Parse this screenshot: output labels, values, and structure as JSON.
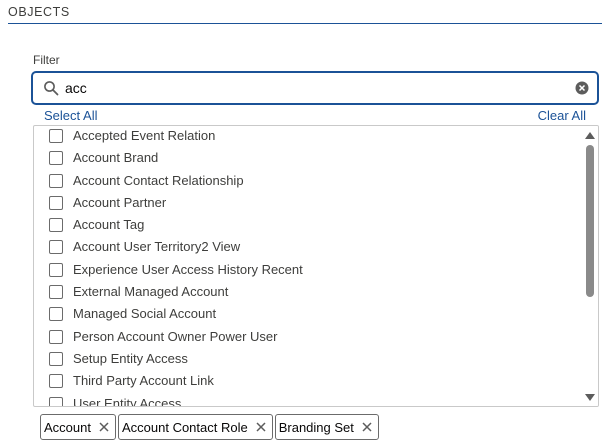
{
  "section": {
    "title": "OBJECTS"
  },
  "filter": {
    "label": "Filter",
    "value": "acc",
    "placeholder": ""
  },
  "actions": {
    "select_all": "Select All",
    "clear_all": "Clear All"
  },
  "items": [
    {
      "label": "Accepted Event Relation",
      "checked": false
    },
    {
      "label": "Account Brand",
      "checked": false
    },
    {
      "label": "Account Contact Relationship",
      "checked": false
    },
    {
      "label": "Account Partner",
      "checked": false
    },
    {
      "label": "Account Tag",
      "checked": false
    },
    {
      "label": "Account User Territory2 View",
      "checked": false
    },
    {
      "label": "Experience User Access History Recent",
      "checked": false
    },
    {
      "label": "External Managed Account",
      "checked": false
    },
    {
      "label": "Managed Social Account",
      "checked": false
    },
    {
      "label": "Person Account Owner Power User",
      "checked": false
    },
    {
      "label": "Setup Entity Access",
      "checked": false
    },
    {
      "label": "Third Party Account Link",
      "checked": false
    },
    {
      "label": "User Entity Access",
      "checked": false
    }
  ],
  "selected": [
    {
      "label": "Account"
    },
    {
      "label": "Account Contact Role"
    },
    {
      "label": "Branding Set"
    }
  ],
  "icons": {
    "search": "search-icon",
    "clear": "clear-circle-icon",
    "remove": "close-icon"
  },
  "colors": {
    "accent": "#1b5297",
    "border": "#c9c9c9",
    "text": "#3e3e3c"
  }
}
